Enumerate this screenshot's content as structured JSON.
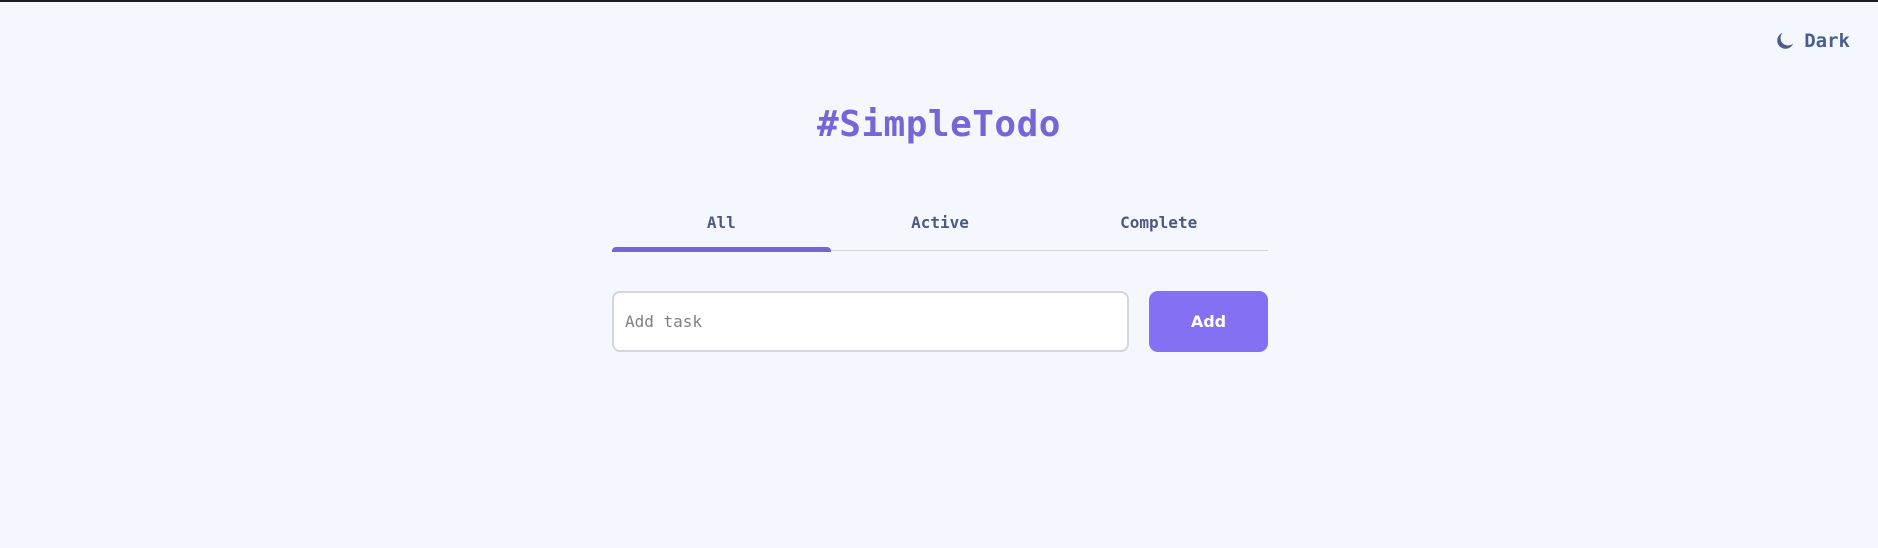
{
  "header": {
    "theme_toggle": {
      "label": "Dark",
      "icon": "moon-icon"
    }
  },
  "app": {
    "title": "#SimpleTodo",
    "accent_color": "#7466d6"
  },
  "tabs": [
    {
      "label": "All",
      "active": true
    },
    {
      "label": "Active",
      "active": false
    },
    {
      "label": "Complete",
      "active": false
    }
  ],
  "task_form": {
    "input_value": "",
    "input_placeholder": "Add task",
    "add_label": "Add",
    "button_color": "#8470f2"
  }
}
